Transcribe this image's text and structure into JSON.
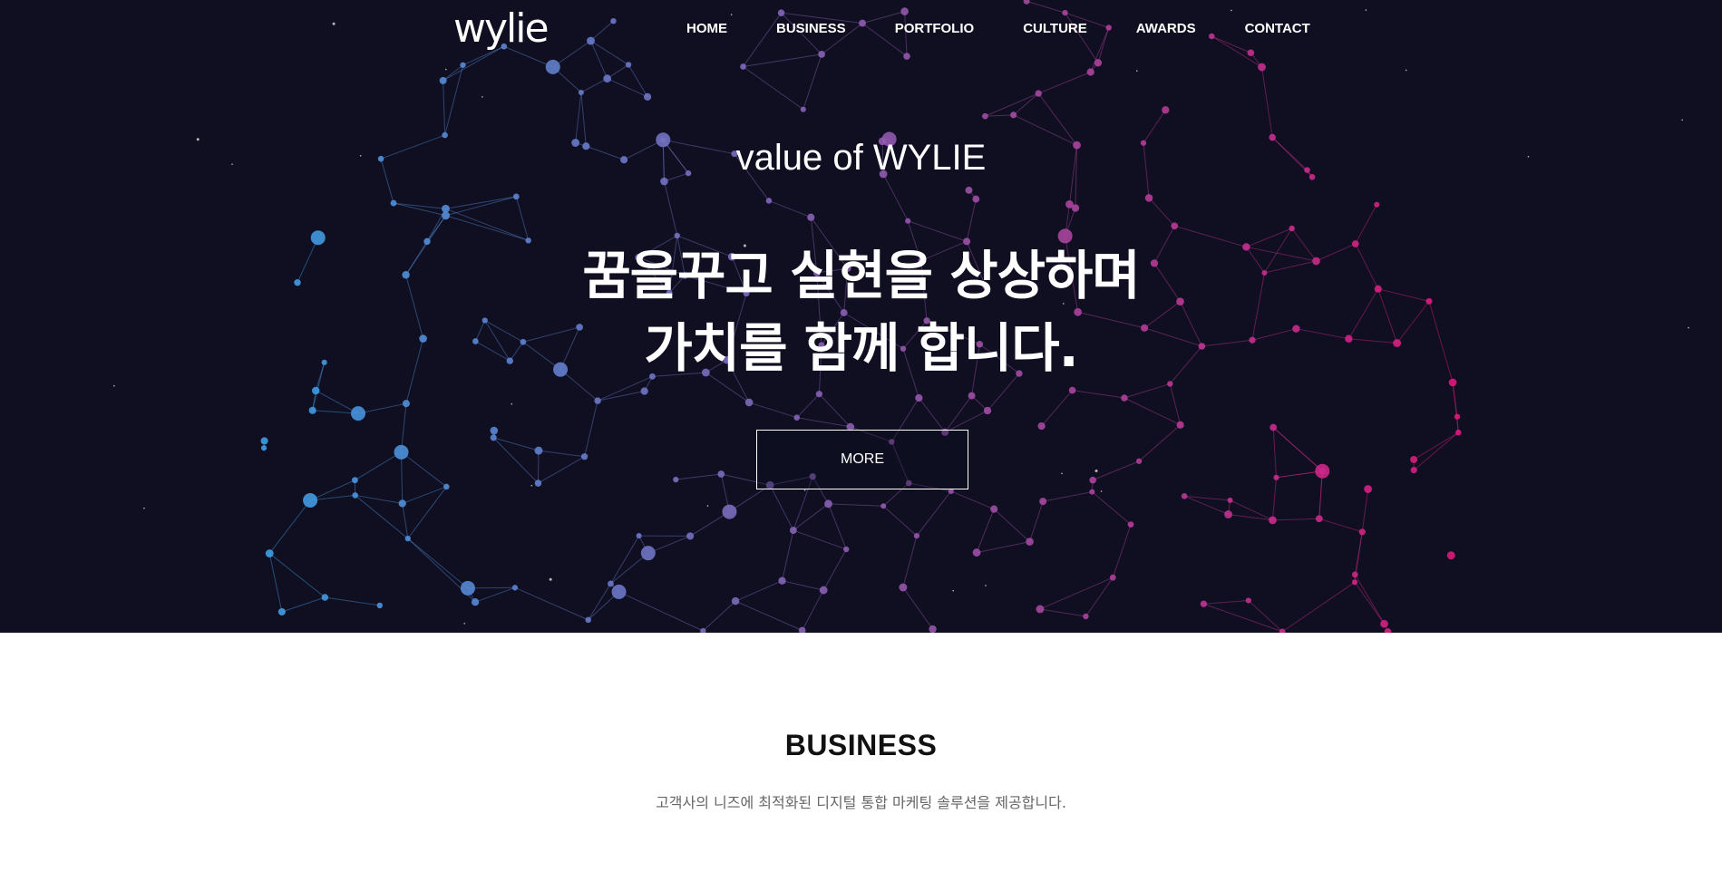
{
  "nav": {
    "logo": "wylie",
    "items": [
      "HOME",
      "BUSINESS",
      "PORTFOLIO",
      "CULTURE",
      "AWARDS",
      "CONTACT"
    ]
  },
  "hero": {
    "tagline": "value of WYLIE",
    "headline_line1": "꿈을꾸고 실현을 상상하며",
    "headline_line2": "가치를 함께 합니다.",
    "more_label": "MORE",
    "background_color": "#0f0f21",
    "accent_blue": "#3aa0e6",
    "accent_pink": "#e0187a"
  },
  "business": {
    "title": "BUSINESS",
    "subtitle": "고객사의 니즈에 최적화된 디지털 통합 마케팅 솔루션을 제공합니다."
  }
}
